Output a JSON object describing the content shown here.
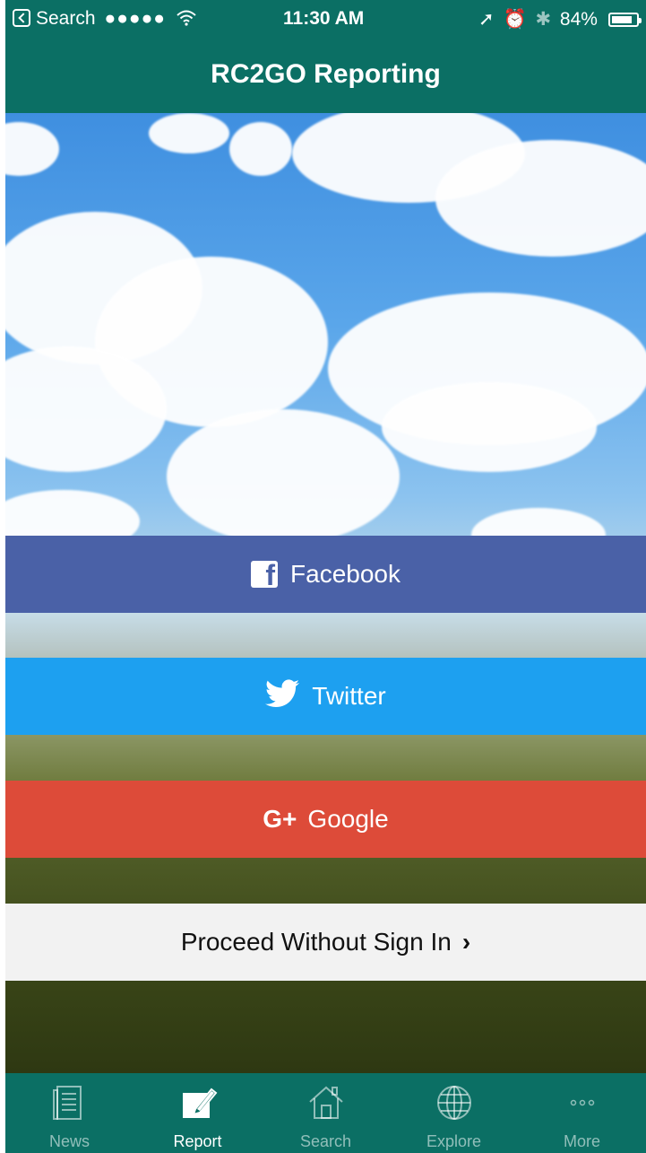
{
  "status_bar": {
    "back_label": "Search",
    "signal": "●●●●●",
    "time": "11:30 AM",
    "battery": "84%",
    "battery_level": 0.84
  },
  "header": {
    "title": "RC2GO Reporting"
  },
  "login": {
    "facebook": "Facebook",
    "twitter": "Twitter",
    "google_icon": "G+",
    "google": "Google",
    "proceed": "Proceed Without Sign In"
  },
  "tabs": [
    {
      "label": "News",
      "icon": "news-icon",
      "active": false
    },
    {
      "label": "Report",
      "icon": "report-icon",
      "active": true
    },
    {
      "label": "Search",
      "icon": "home-icon",
      "active": false
    },
    {
      "label": "Explore",
      "icon": "globe-icon",
      "active": false
    },
    {
      "label": "More",
      "icon": "more-icon",
      "active": false
    }
  ],
  "colors": {
    "bar": "#0b6f64",
    "facebook": "#4a61a7",
    "twitter": "#1da0f0",
    "google": "#dd4b39",
    "proceed": "#f2f2f2"
  }
}
